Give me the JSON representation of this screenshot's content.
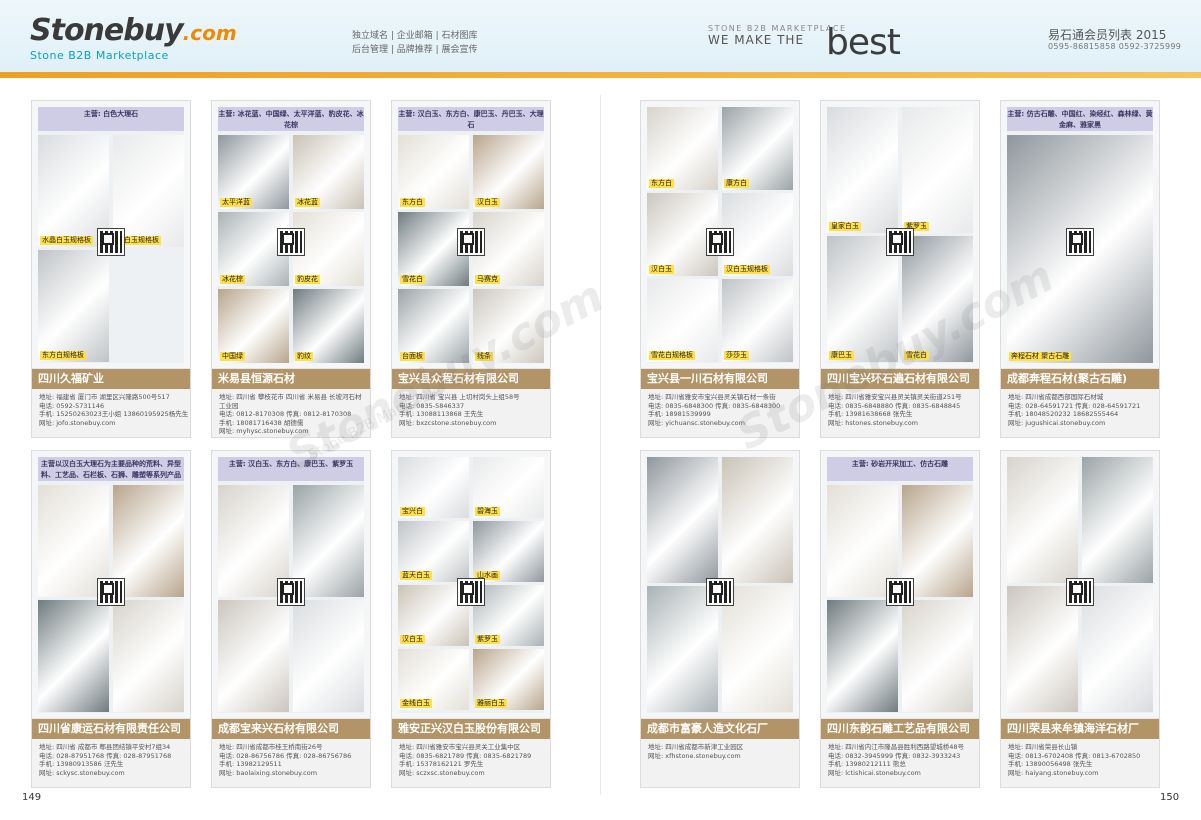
{
  "header": {
    "logo_main": "Stonebuy",
    "logo_dotcom": ".com",
    "logo_sub": "Stone B2B Marketplace",
    "services_line1": "独立域名 | 企业邮箱 | 石材图库",
    "services_line2": "后台管理 | 品牌推荐 | 展会宣传",
    "tag_small": "STONE B2B MARKETPLACE",
    "tag_we": "WE MAKE THE",
    "tag_best": "best",
    "member_title": "易石通会员列表 2015",
    "member_phones": "0595-86815858   0592-3725999"
  },
  "pages": {
    "left": "149",
    "right": "150"
  },
  "watermark": "Stonebuy.com",
  "watermark_sub": "Stone B2B Marketplace",
  "colors": {
    "accent_orange": "#f0a020",
    "company_bar": "#b39466",
    "banner": "#cfcde6"
  },
  "cards": [
    {
      "main": "主营: 白色大理石",
      "name": "四川久福矿业",
      "tiles": [
        "水晶白玉规格板",
        "汉白玉规格板",
        "东方白规格板"
      ],
      "details": [
        "地址: 福建省 厦门市 湖里区兴隆路500号517",
        "电话: 0592-5731146",
        "手机: 15250263023王小姐 13860195925杨先生",
        "网址: jofo.stonebuy.com"
      ]
    },
    {
      "main": "主营: 冰花蓝、中国绿、太平洋蓝、豹皮花、冰花棕",
      "name": "米易县恒源石材",
      "tiles": [
        "太平洋蓝",
        "冰花蓝",
        "冰花棕",
        "豹皮花",
        "中国绿",
        "豹纹"
      ],
      "details": [
        "地址: 四川省 攀枝花市 四川省 米易县 长坡河石材",
        "工业园",
        "电话: 0812-8170308  传真: 0812-8170308",
        "手机: 18081716438 胡德儒",
        "网址: myhysc.stonebuy.com"
      ]
    },
    {
      "main": "主营: 汉白玉、东方白、康巴玉、丹巴玉、大理石",
      "name": "宝兴县众程石材有限公司",
      "tiles": [
        "东方白",
        "汉白玉",
        "雪花白",
        "马赛克",
        "台面板",
        "线条"
      ],
      "details": [
        "地址: 四川省 宝兴县 上切村岗头上组58号",
        "电话: 0835-5846337",
        "手机: 13088113868 王先生",
        "网址: bxzcstone.stonebuy.com"
      ]
    },
    {
      "main": "",
      "name": "宝兴县一川石材有限公司",
      "tiles": [
        "东方白",
        "康方白",
        "汉白玉",
        "汉白玉规格板",
        "雪花白规格板",
        "莎莎玉"
      ],
      "details": [
        "地址: 四川省雅安市宝兴县灵关镇石材一条街",
        "电话: 0835-6848300  传真: 0835-6848300",
        "手机: 18981539999",
        "网址: yichuansc.stonebuy.com"
      ]
    },
    {
      "main": "",
      "name": "四川宝兴环石遍石材有限公司",
      "tiles": [
        "皇家白玉",
        "紫罗玉",
        "康巴玉",
        "雪花白"
      ],
      "details": [
        "地址: 四川省雅安宝兴县灵关镇灵关街道251号",
        "电话: 0835-6848880  传真: 0835-6848845",
        "手机: 13981638668 张先生",
        "网址: hstones.stonebuy.com"
      ]
    },
    {
      "main": "主营: 仿古石雕、中国红、染经红、森林绿、黄金麻、雅家黑",
      "name": "成都奔程石材(聚古石雕)",
      "tiles": [
        "奔程石材 聚古石雕"
      ],
      "details": [
        "地址: 四川省成都西部国际石材城",
        "电话: 028-64591721  传真: 028-64591721",
        "手机: 18048520232  18682555464",
        "网址: jugushicai.stonebuy.com"
      ]
    },
    {
      "main": "主营以汉白玉大理石为主要品种的荒料、异型料、工艺品、石栏板、石狮、雕塑等系列产品",
      "name": "四川省康运石材有限责任公司",
      "tiles": [],
      "details": [
        "地址: 四川省 成都市 郫县团结镇平安村7组34",
        "电话: 028-87951768  传真: 028-87951768",
        "手机: 13980913586 汪先生",
        "网址: sckysc.stonebuy.com"
      ]
    },
    {
      "main": "主营: 汉白玉、东方白、康巴玉、紫罗玉",
      "name": "成都宝来兴石材有限公司",
      "tiles": [],
      "details": [
        "地址: 四川省成都市桂王桥南街26号",
        "电话: 028-86756786  传真: 028-86756786",
        "手机: 13982129511",
        "网址: baolaixing.stonebuy.com"
      ]
    },
    {
      "main": "",
      "name": "雅安正兴汉白玉股份有限公司",
      "tiles": [
        "宝兴白",
        "碧海玉",
        "蓝天白玉",
        "山水画",
        "汉白玉",
        "紫罗玉",
        "金线白玉",
        "雅丽白玉"
      ],
      "details": [
        "地址: 四川省雅安市宝兴县灵关工业集中区",
        "电话: 0835-6821789  传真: 0835-6821789",
        "手机: 15378162121 罗先生",
        "网址: sczxsc.stonebuy.com"
      ]
    },
    {
      "main": "",
      "name": "成都市富豪人造文化石厂",
      "tiles": [],
      "details": [
        "地址: 四川省成都市新津工业园区",
        "网址: xfhstone.stonebuy.com"
      ]
    },
    {
      "main": "主营: 砂岩开采加工、仿古石雕",
      "name": "四川东韵石雕工艺品有限公司",
      "tiles": [],
      "details": [
        "地址: 四川省内江市隆昌县胜利西路望城桥48号",
        "电话: 0832-3945999  传真: 0832-3933243",
        "手机: 13980212111 熊总",
        "网址: lctishicai.stonebuy.com"
      ]
    },
    {
      "main": "",
      "name": "四川荣县来牟镇海洋石材厂",
      "tiles": [],
      "details": [
        "地址: 四川省荣县长山镇",
        "电话: 0813-6702408  传真: 0813-6702850",
        "手机: 13890056498 张先生",
        "网址: haiyang.stonebuy.com"
      ]
    }
  ]
}
